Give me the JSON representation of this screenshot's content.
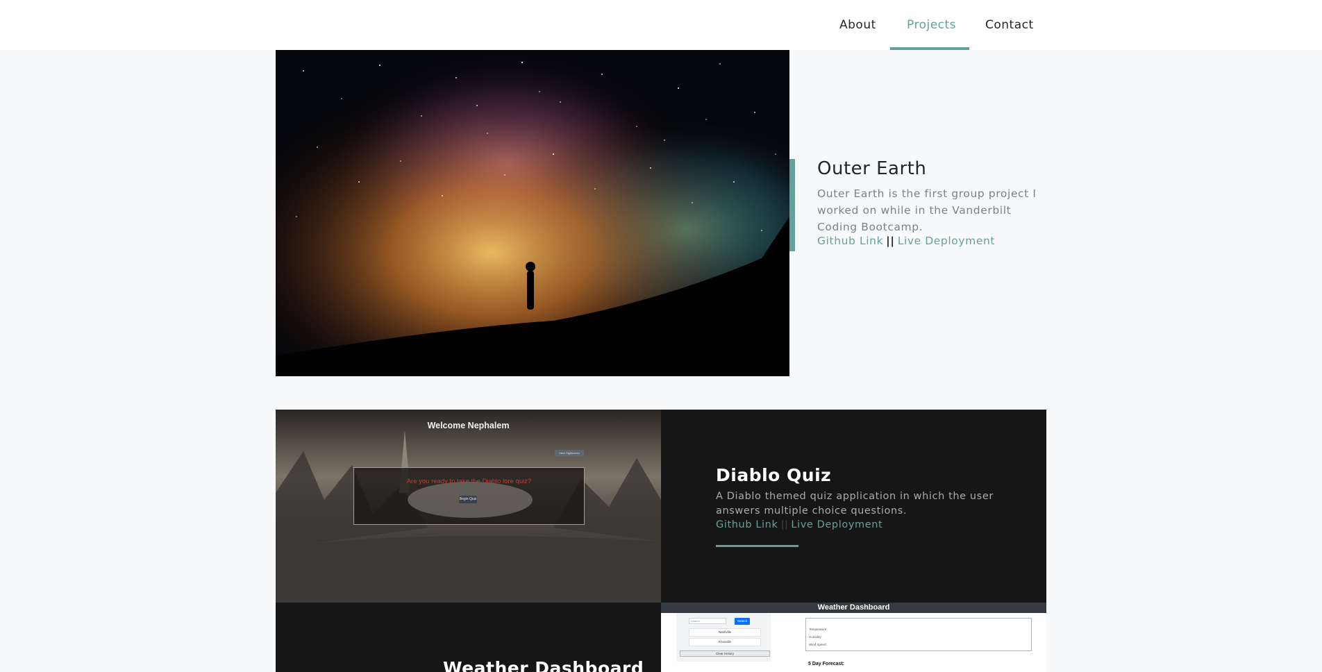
{
  "nav": {
    "items": [
      {
        "label": "About"
      },
      {
        "label": "Projects"
      },
      {
        "label": "Contact"
      }
    ],
    "active": "Projects",
    "accent_color": "#64a19d"
  },
  "featured": {
    "title": "Outer Earth",
    "description": "Outer Earth is the first group project I worked on while in the Vanderbilt Coding Bootcamp.",
    "github_label": "Github Link",
    "separator": "||",
    "live_label": "Live Deployment",
    "image_icon": "milky-way-night-sky-photo"
  },
  "projects": [
    {
      "title": "Diablo Quiz",
      "description": "A Diablo themed quiz application in which the user answers multiple choice questions.",
      "github_label": "Github Link",
      "separator": "||",
      "live_label": "Live Deployment",
      "screenshot": {
        "welcome": "Welcome Nephalem",
        "top_button": "View Highscores",
        "question": "Are you ready to take the Diablo lore quiz?",
        "begin_button": "Begin Quiz"
      }
    },
    {
      "title": "Weather Dashboard",
      "screenshot": {
        "header": "Weather Dashboard",
        "search_placeholder": "Search",
        "search_button": "Search",
        "cities": [
          "Nashville",
          "Knoxville"
        ],
        "clear_button": "Clear History",
        "stats": [
          "Temperature:",
          "Humidity:",
          "Wind Speed:"
        ],
        "forecast_heading": "5 Day Forecast:"
      }
    }
  ]
}
